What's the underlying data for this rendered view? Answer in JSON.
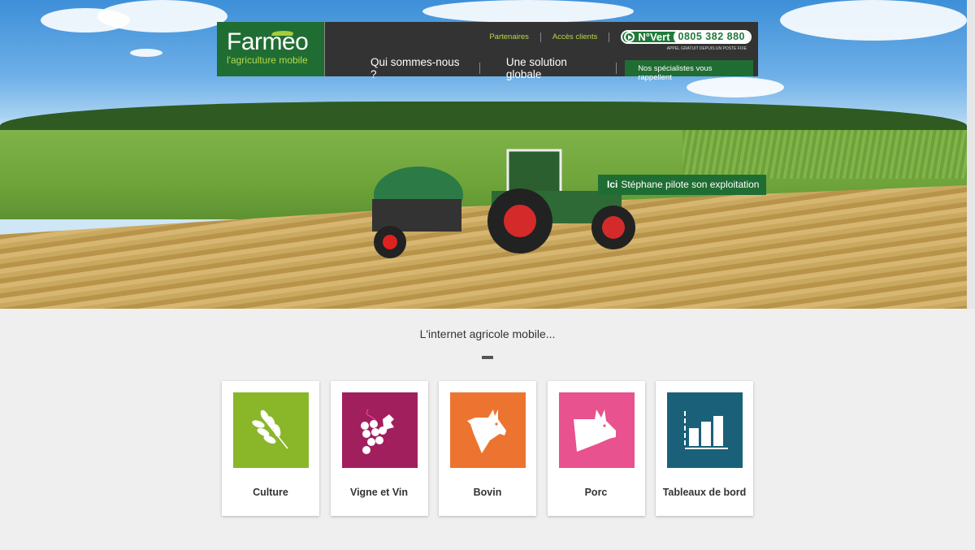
{
  "header": {
    "logo_name": "Farmeo",
    "logo_tagline": "l'agriculture mobile",
    "links": [
      "Partenaires",
      "Accès clients"
    ],
    "phone_label": "N°Vert",
    "phone_number": "0805 382 880",
    "phone_note": "APPEL GRATUIT DEPUIS UN POSTE FIXE",
    "menu": [
      "Qui sommes-nous ?",
      "Une solution globale"
    ],
    "cta": "Nos spécialistes vous rappellent"
  },
  "hero": {
    "badge_bold": "Ici",
    "badge_text": "Stéphane pilote son exploitation"
  },
  "section": {
    "title": "L'internet agricole mobile..."
  },
  "cards": [
    {
      "label": "Culture",
      "icon": "wheat-icon",
      "color": "#8ab72a"
    },
    {
      "label": "Vigne et Vin",
      "icon": "grapes-icon",
      "color": "#a21f5e"
    },
    {
      "label": "Bovin",
      "icon": "cow-icon",
      "color": "#ec7430"
    },
    {
      "label": "Porc",
      "icon": "pig-icon",
      "color": "#e8528e"
    },
    {
      "label": "Tableaux de bord",
      "icon": "bar-chart-icon",
      "color": "#1a6079"
    }
  ]
}
